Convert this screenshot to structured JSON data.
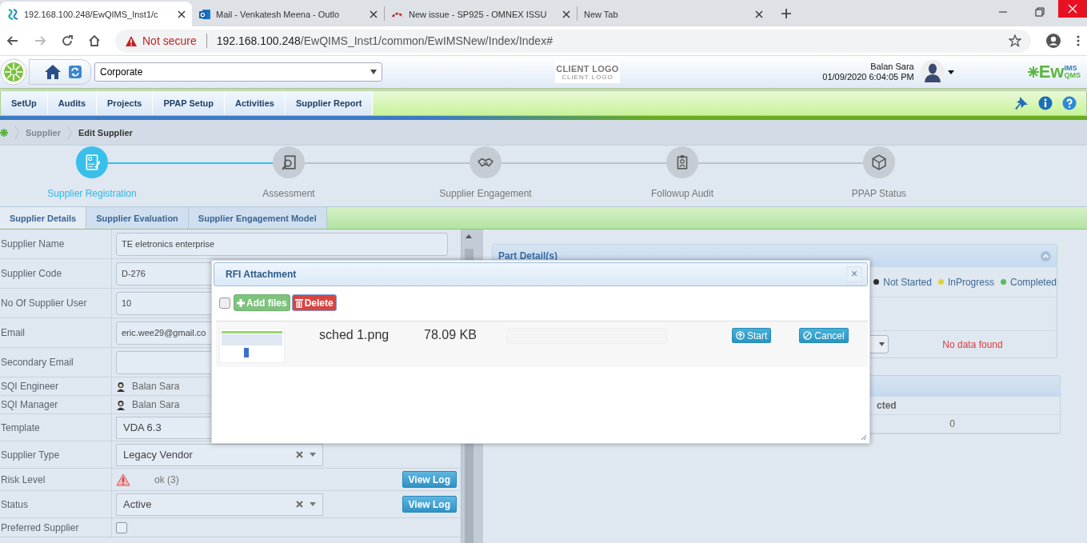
{
  "browser": {
    "tabs": [
      {
        "kind": "app",
        "title": "192.168.100.248/EwQIMS_Inst1/c",
        "selected": true
      },
      {
        "kind": "mail",
        "title": "Mail - Venkatesh Meena - Outlo",
        "selected": false
      },
      {
        "kind": "tracker",
        "title": "New issue - SP925 - OMNEX ISSU",
        "selected": false
      },
      {
        "kind": "blank",
        "title": "New Tab",
        "selected": false
      }
    ],
    "security": "Not secure",
    "url_host": "192.168.100.248",
    "url_path": "/EwQIMS_Inst1/common/EwIMSNew/Index/Index#"
  },
  "header": {
    "site": "Corporate",
    "client_logo": "CLIENT LOGO",
    "client_logo_sub": "CLIENT LOGO",
    "user": "Balan Sara",
    "datetime": "01/09/2020 6:04:05 PM",
    "logo": {
      "main": "Ew",
      "sup": "IMS",
      "sub": "QMS"
    }
  },
  "menu": [
    "SetUp",
    "Audits",
    "Projects",
    "PPAP Setup",
    "Activities",
    "Supplier Report"
  ],
  "breadcrumb": [
    "Supplier",
    "Edit Supplier"
  ],
  "steps": [
    {
      "kind": "registration",
      "label": "Supplier Registration",
      "selected": true
    },
    {
      "kind": "assessment",
      "label": "Assessment",
      "selected": false
    },
    {
      "kind": "engagement",
      "label": "Supplier Engagement",
      "selected": false
    },
    {
      "kind": "audit",
      "label": "Followup Audit",
      "selected": false
    },
    {
      "kind": "ppap",
      "label": "PPAP Status",
      "selected": false
    }
  ],
  "tabs": [
    {
      "label": "Supplier Details",
      "selected": true
    },
    {
      "label": "Supplier Evaluation",
      "selected": false
    },
    {
      "label": "Supplier Engagement Model",
      "selected": false
    }
  ],
  "form": {
    "rows": [
      {
        "kind": "input",
        "label": "Supplier Name",
        "value": "TE eletronics enterprise"
      },
      {
        "kind": "input",
        "label": "Supplier Code",
        "value": "D-276"
      },
      {
        "kind": "input",
        "label": "No Of Supplier User",
        "value": "10"
      },
      {
        "kind": "input",
        "label": "Email",
        "value": "eric.wee29@gmail.co"
      },
      {
        "kind": "input",
        "label": "Secondary Email"
      },
      {
        "kind": "person",
        "label": "SQI Engineer",
        "value": "Balan Sara"
      },
      {
        "kind": "person",
        "label": "SQI Manager",
        "value": "Balan Sara"
      },
      {
        "kind": "select",
        "label": "Template",
        "value": "VDA 6.3"
      },
      {
        "kind": "select",
        "label": "Supplier Type",
        "value": "Legacy Vendor"
      },
      {
        "kind": "risk",
        "label": "Risk Level",
        "value": "ok (3)",
        "button": "View Log"
      },
      {
        "kind": "select",
        "label": "Status",
        "value": "Active",
        "button": "View Log"
      },
      {
        "kind": "checkbox",
        "label": "Preferred Supplier",
        "checked": false
      }
    ]
  },
  "part_details": {
    "title": "Part Detail(s)",
    "legend": [
      {
        "label": "Not Started",
        "color": "#2d2d2d"
      },
      {
        "label": "InProgress",
        "color": "#e0d433"
      },
      {
        "label": "Completed",
        "color": "#5cb85c"
      }
    ],
    "message": "No data found"
  },
  "summary": {
    "columns": [
      "cted"
    ],
    "rows": [
      [
        "0"
      ]
    ]
  },
  "dialog": {
    "title": "RFI Attachment",
    "close": "×",
    "select_all": {
      "checked": false
    },
    "add": "Add files",
    "delete": "Delete",
    "files": [
      {
        "name": "sched 1.png",
        "size": "78.09 KB",
        "level": 0,
        "start": "Start",
        "cancel": "Cancel"
      }
    ]
  }
}
